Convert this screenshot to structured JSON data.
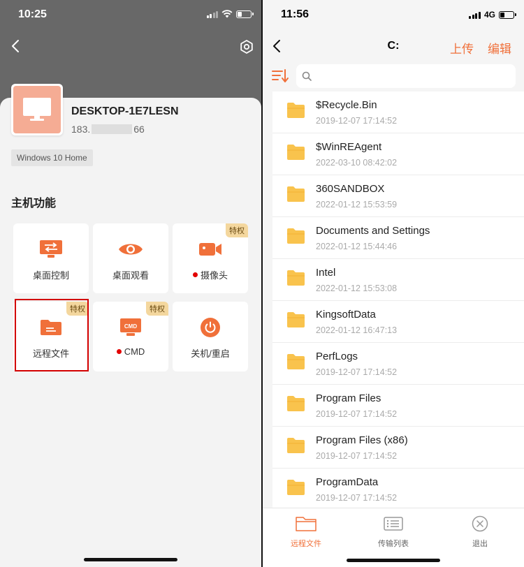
{
  "left": {
    "status_time": "10:25",
    "host_name": "DESKTOP-1E7LESN",
    "ip_prefix": "183.",
    "ip_suffix": "66",
    "os": "Windows 10 Home",
    "section_title": "主机功能",
    "badge_label": "特权",
    "tiles": [
      {
        "label": "桌面控制",
        "icon": "desktop-control-icon",
        "privileged": false,
        "dot": false
      },
      {
        "label": "桌面观看",
        "icon": "eye-icon",
        "privileged": false,
        "dot": false
      },
      {
        "label": "摄像头",
        "icon": "camera-icon",
        "privileged": true,
        "dot": true
      },
      {
        "label": "远程文件",
        "icon": "folder-icon",
        "privileged": true,
        "dot": false,
        "highlighted": true
      },
      {
        "label": "CMD",
        "icon": "cmd-icon",
        "privileged": true,
        "dot": true
      },
      {
        "label": "关机/重启",
        "icon": "power-icon",
        "privileged": false,
        "dot": false
      }
    ]
  },
  "right": {
    "status_time": "11:56",
    "network": "4G",
    "title": "C:",
    "upload_label": "上传",
    "edit_label": "编辑",
    "files": [
      {
        "name": "$Recycle.Bin",
        "date": "2019-12-07 17:14:52"
      },
      {
        "name": "$WinREAgent",
        "date": "2022-03-10 08:42:02"
      },
      {
        "name": "360SANDBOX",
        "date": "2022-01-12 15:53:59"
      },
      {
        "name": "Documents and Settings",
        "date": "2022-01-12 15:44:46"
      },
      {
        "name": "Intel",
        "date": "2022-01-12 15:53:08"
      },
      {
        "name": "KingsoftData",
        "date": "2022-01-12 16:47:13"
      },
      {
        "name": "PerfLogs",
        "date": "2019-12-07 17:14:52"
      },
      {
        "name": "Program Files",
        "date": "2019-12-07 17:14:52"
      },
      {
        "name": "Program Files (x86)",
        "date": "2019-12-07 17:14:52"
      },
      {
        "name": "ProgramData",
        "date": "2019-12-07 17:14:52"
      }
    ],
    "tabs": [
      {
        "label": "远程文件",
        "active": true
      },
      {
        "label": "传输列表",
        "active": false
      },
      {
        "label": "退出",
        "active": false
      }
    ]
  },
  "colors": {
    "accent": "#f0703a",
    "folder": "#f9c34d",
    "badge_bg": "#f4d79e",
    "highlight": "#d30000",
    "avatar": "#f5ac94"
  }
}
